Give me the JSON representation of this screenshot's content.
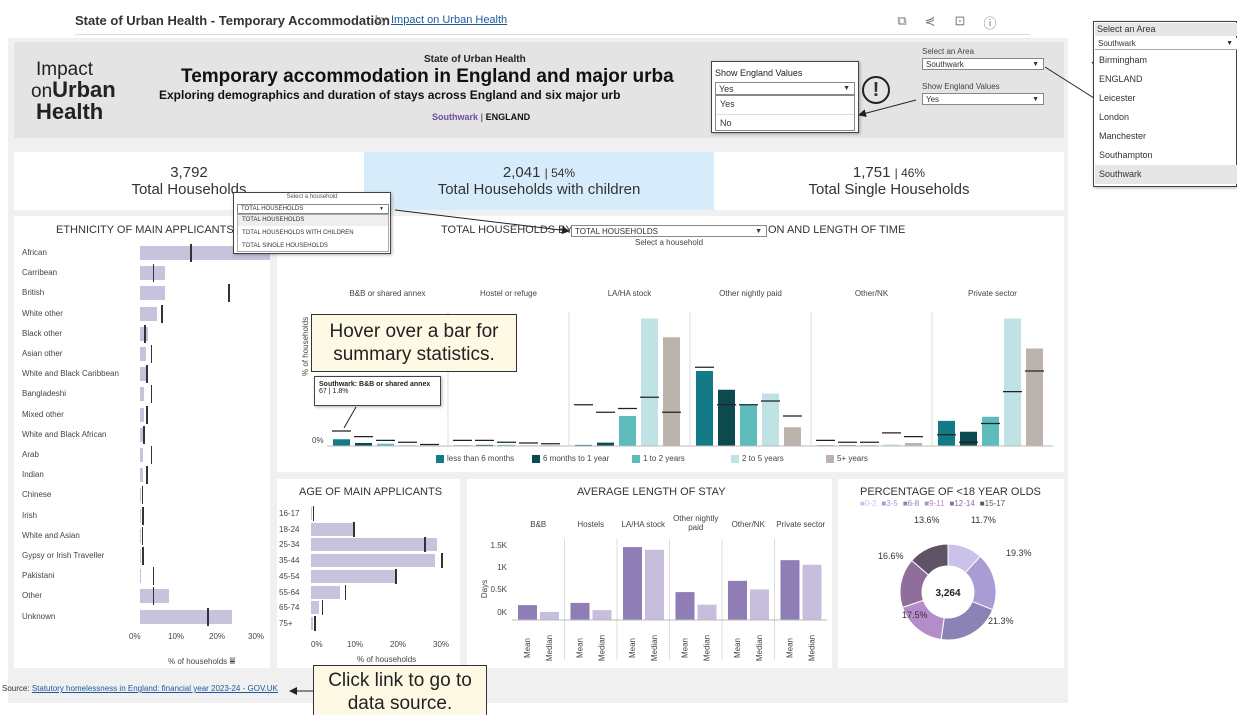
{
  "topbar": {
    "title": "State of Urban Health - Temporary Accommodation",
    "by": "by",
    "author_link": "Impact on Urban Health",
    "icons": [
      "copy-icon",
      "share-icon",
      "present-icon",
      "info-icon"
    ]
  },
  "header": {
    "logo_line1": "Impact",
    "logo_line2a": "on",
    "logo_line2b": "Urban",
    "logo_line3": "Health",
    "kicker": "State of Urban Health",
    "title": "Temporary accommodation in England and major urba",
    "subtitle": "Exploring demographics and duration of stays across England and six major urb",
    "area": "Southwark",
    "sep": "|",
    "england": "ENGLAND",
    "select_area_label": "Select an Area",
    "select_area_value": "Southwark",
    "show_england_label": "Show England Values",
    "show_england_value": "Yes",
    "exclamation": "!"
  },
  "england_popup": {
    "label": "Show England Values",
    "value": "Yes",
    "options": [
      "Yes",
      "No"
    ]
  },
  "area_popup": {
    "label": "Select an Area",
    "value": "Southwark",
    "options": [
      "Birmingham",
      "ENGLAND",
      "Leicester",
      "London",
      "Manchester",
      "Southampton",
      "Southwark"
    ]
  },
  "kpis": [
    {
      "number": "3,792",
      "label": "Total Households"
    },
    {
      "number": "2,041",
      "pct": "| 54%",
      "label": "Total Households with children"
    },
    {
      "number": "1,751",
      "pct": "| 46%",
      "label": "Total Single Households"
    }
  ],
  "household_popup": {
    "label": "Select a household",
    "value": "TOTAL HOUSEHOLDS",
    "options": [
      "TOTAL HOUSEHOLDS",
      "TOTAL HOUSEHOLDS WITH CHILDREN",
      "TOTAL SINGLE HOUSEHOLDS"
    ]
  },
  "ethnicity": {
    "title": "ETHNICITY OF MAIN APPLICANTS",
    "xlabel": "% of households",
    "sort_icon": "sort-icon",
    "ticks": [
      "0%",
      "10%",
      "20%",
      "30%"
    ],
    "rows": [
      {
        "label": "African",
        "value": 39,
        "eng": 12
      },
      {
        "label": "Carribean",
        "value": 6,
        "eng": 3
      },
      {
        "label": "British",
        "value": 6,
        "eng": 21
      },
      {
        "label": "White other",
        "value": 4,
        "eng": 5
      },
      {
        "label": "Black other",
        "value": 2,
        "eng": 1
      },
      {
        "label": "Asian other",
        "value": 1.5,
        "eng": 2.5
      },
      {
        "label": "White and Black Caribbean",
        "value": 1.5,
        "eng": 1.5
      },
      {
        "label": "Bangladeshi",
        "value": 1,
        "eng": 2.5
      },
      {
        "label": "Mixed other",
        "value": 1,
        "eng": 1.5
      },
      {
        "label": "White and Black African",
        "value": 1,
        "eng": 0.8
      },
      {
        "label": "Arab",
        "value": 0.8,
        "eng": 2.5
      },
      {
        "label": "Indian",
        "value": 0.7,
        "eng": 1.5
      },
      {
        "label": "Chinese",
        "value": 0.3,
        "eng": 0.4
      },
      {
        "label": "Irish",
        "value": 0.3,
        "eng": 0.5
      },
      {
        "label": "White and Asian",
        "value": 0.3,
        "eng": 0.4
      },
      {
        "label": "Gypsy or Irish Traveller",
        "value": 0.1,
        "eng": 0.5
      },
      {
        "label": "Pakistani",
        "value": 0.2,
        "eng": 3
      },
      {
        "label": "Other",
        "value": 7,
        "eng": 3
      },
      {
        "label": "Unknown",
        "value": 22,
        "eng": 16
      }
    ]
  },
  "tenure": {
    "title_left": "TOTAL HOUSEHOLDS BY",
    "title_right": "ON AND LENGTH OF TIME",
    "select_value": "TOTAL HOUSEHOLDS",
    "select_label": "Select a household",
    "ylabel": "% of households",
    "y0": "0%",
    "categories": [
      "B&B or shared annex",
      "Hostel or refuge",
      "LA/HA stock",
      "Other nightly paid",
      "Other/NK",
      "Private sector"
    ],
    "legend": [
      "less than 6 months",
      "6 months to 1 year",
      "1 to 2 years",
      "2 to 5 years",
      "5+ years"
    ],
    "colors": [
      "#137a87",
      "#0c4a4f",
      "#5fbcbc",
      "#bfe3e5",
      "#bdb3ad"
    ],
    "values": [
      [
        1.8,
        0.8,
        0.6,
        0.3,
        0.2
      ],
      [
        0.2,
        0.3,
        0.3,
        0.2,
        0.2
      ],
      [
        0.3,
        0.9,
        8.0,
        34,
        29
      ],
      [
        20,
        15,
        11,
        14,
        5
      ],
      [
        0.2,
        0.2,
        0.2,
        0.4,
        0.8
      ],
      [
        6.7,
        3.8,
        7.8,
        34,
        26
      ]
    ],
    "england": [
      [
        4,
        2.5,
        1.5,
        1,
        0.4
      ],
      [
        1.5,
        1.5,
        1,
        0.8,
        0.6
      ],
      [
        11,
        9,
        10,
        13,
        9
      ],
      [
        21,
        11,
        11,
        12,
        8
      ],
      [
        1.5,
        1,
        1,
        3.5,
        2.5
      ],
      [
        3,
        1,
        6,
        14.5,
        20
      ]
    ],
    "tooltip_title": "Southwark: B&B or shared annex",
    "tooltip_value": "67 | 1.8%"
  },
  "age": {
    "title": "AGE OF MAIN APPLICANTS",
    "xlabel": "% of households",
    "ticks": [
      "0%",
      "10%",
      "20%",
      "30%"
    ],
    "rows": [
      {
        "label": "16-17",
        "value": 0.2,
        "eng": 0.4
      },
      {
        "label": "18-24",
        "value": 10,
        "eng": 10
      },
      {
        "label": "25-34",
        "value": 30,
        "eng": 27
      },
      {
        "label": "35-44",
        "value": 29.5,
        "eng": 31
      },
      {
        "label": "45-54",
        "value": 20,
        "eng": 20
      },
      {
        "label": "55-64",
        "value": 7,
        "eng": 8
      },
      {
        "label": "65-74",
        "value": 2,
        "eng": 2.5
      },
      {
        "label": "75+",
        "value": 0.4,
        "eng": 0.8
      }
    ]
  },
  "stay": {
    "title": "AVERAGE LENGTH OF STAY",
    "ylabel": "Days",
    "yticks": [
      "1.5K",
      "1K",
      "0.5K",
      "0K"
    ],
    "groups": [
      "B&B",
      "Hostels",
      "LA/HA stock",
      "Other nightly paid",
      "Other/NK",
      "Private sector"
    ],
    "sub": [
      "Mean",
      "Median"
    ],
    "values": [
      [
        330,
        180
      ],
      [
        380,
        220
      ],
      [
        1620,
        1560
      ],
      [
        620,
        340
      ],
      [
        870,
        680
      ],
      [
        1330,
        1230
      ]
    ]
  },
  "under18": {
    "title": "PERCENTAGE OF <18 YEAR OLDS",
    "legend": [
      "0-2",
      "3-5",
      "6-8",
      "9-11",
      "12-14",
      "15-17"
    ],
    "colors": [
      "#cbc2ea",
      "#a99cd3",
      "#8c82b5",
      "#b48cc9",
      "#8f6e9c",
      "#5f5368"
    ],
    "values": [
      11.7,
      19.3,
      21.3,
      17.5,
      16.6,
      13.6
    ],
    "labels": [
      "11.7%",
      "19.3%",
      "21.3%",
      "17.5%",
      "16.6%",
      "13.6%"
    ],
    "center": "3,264"
  },
  "annotations": {
    "hover": "Hover over a bar for summary statistics.",
    "click": "Click link to go to data source."
  },
  "footer": {
    "source_label": "Source:",
    "source_link": "Statutory homelessness in England: financial year 2023-24 - GOV.UK"
  }
}
